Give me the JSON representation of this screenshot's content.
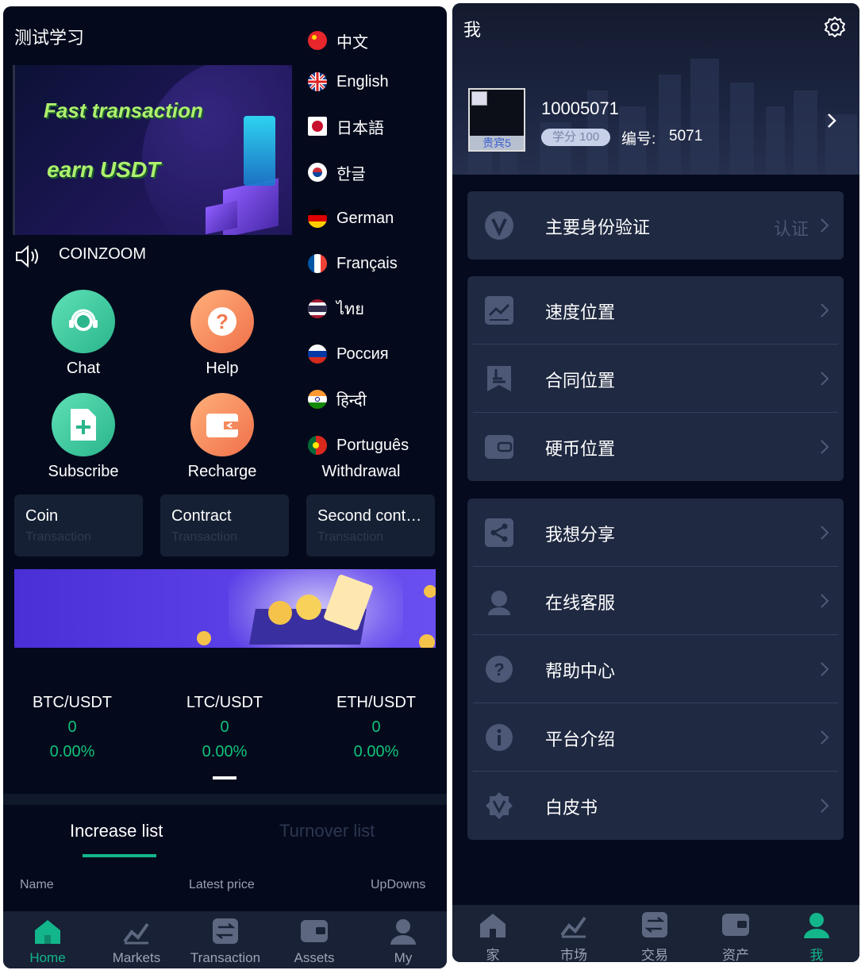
{
  "left": {
    "app_title": "测试学习",
    "banner": {
      "line1": "Fast transaction",
      "line2": "earn USDT"
    },
    "languages": [
      {
        "label": "中文",
        "icon": "china-flag-icon"
      },
      {
        "label": "English",
        "icon": "uk-flag-icon"
      },
      {
        "label": "日本語",
        "icon": "japan-flag-icon"
      },
      {
        "label": "한글",
        "icon": "korea-flag-icon"
      },
      {
        "label": "German",
        "icon": "germany-flag-icon"
      },
      {
        "label": "Français",
        "icon": "france-flag-icon"
      },
      {
        "label": "ไทย",
        "icon": "thailand-flag-icon"
      },
      {
        "label": "Россия",
        "icon": "russia-flag-icon"
      },
      {
        "label": "हिन्दी",
        "icon": "india-flag-icon"
      },
      {
        "label": "Português",
        "icon": "portugal-flag-icon"
      }
    ],
    "notice": "COINZOOM",
    "quick_actions": [
      {
        "label": "Chat",
        "icon": "headset-icon"
      },
      {
        "label": "Help",
        "icon": "question-icon"
      },
      {
        "label": "Subscribe",
        "icon": "add-document-icon"
      },
      {
        "label": "Recharge",
        "icon": "wallet-icon"
      },
      {
        "label": "Withdrawal",
        "icon": ""
      }
    ],
    "trade_tabs": [
      {
        "title": "Coin",
        "sub": "Transaction"
      },
      {
        "title": "Contract",
        "sub": "Transaction"
      },
      {
        "title": "Second contract",
        "sub": "Transaction"
      }
    ],
    "tickers": [
      {
        "pair": "BTC/USDT",
        "price": "0",
        "change": "0.00%"
      },
      {
        "pair": "LTC/USDT",
        "price": "0",
        "change": "0.00%"
      },
      {
        "pair": "ETH/USDT",
        "price": "0",
        "change": "0.00%"
      }
    ],
    "list_tabs": {
      "increase": "Increase list",
      "turnover": "Turnover list"
    },
    "columns": {
      "name": "Name",
      "price": "Latest price",
      "updowns": "UpDowns"
    },
    "nav": [
      {
        "label": "Home",
        "icon": "home-icon",
        "active": true
      },
      {
        "label": "Markets",
        "icon": "chart-icon"
      },
      {
        "label": "Transaction",
        "icon": "exchange-icon"
      },
      {
        "label": "Assets",
        "icon": "wallet-icon"
      },
      {
        "label": "My",
        "icon": "user-icon"
      }
    ],
    "colors": {
      "accent": "#13b58b",
      "up": "#13c27a",
      "bg": "#040a1c"
    }
  },
  "right": {
    "title": "我",
    "user": {
      "id": "10005071",
      "vip": "贵宾5",
      "score": "学分 100",
      "serial_label": "编号:",
      "serial": "5071"
    },
    "verify": {
      "label": "主要身份验证",
      "extra": "认证"
    },
    "group1": [
      "速度位置",
      "合同位置",
      "硬币位置"
    ],
    "group2": [
      "我想分享",
      "在线客服",
      "帮助中心",
      "平台介绍",
      "白皮书"
    ],
    "nav": [
      {
        "label": "家",
        "icon": "home-icon"
      },
      {
        "label": "市场",
        "icon": "chart-icon"
      },
      {
        "label": "交易",
        "icon": "exchange-icon"
      },
      {
        "label": "资产",
        "icon": "wallet-icon"
      },
      {
        "label": "我",
        "icon": "user-icon",
        "active": true
      }
    ]
  }
}
